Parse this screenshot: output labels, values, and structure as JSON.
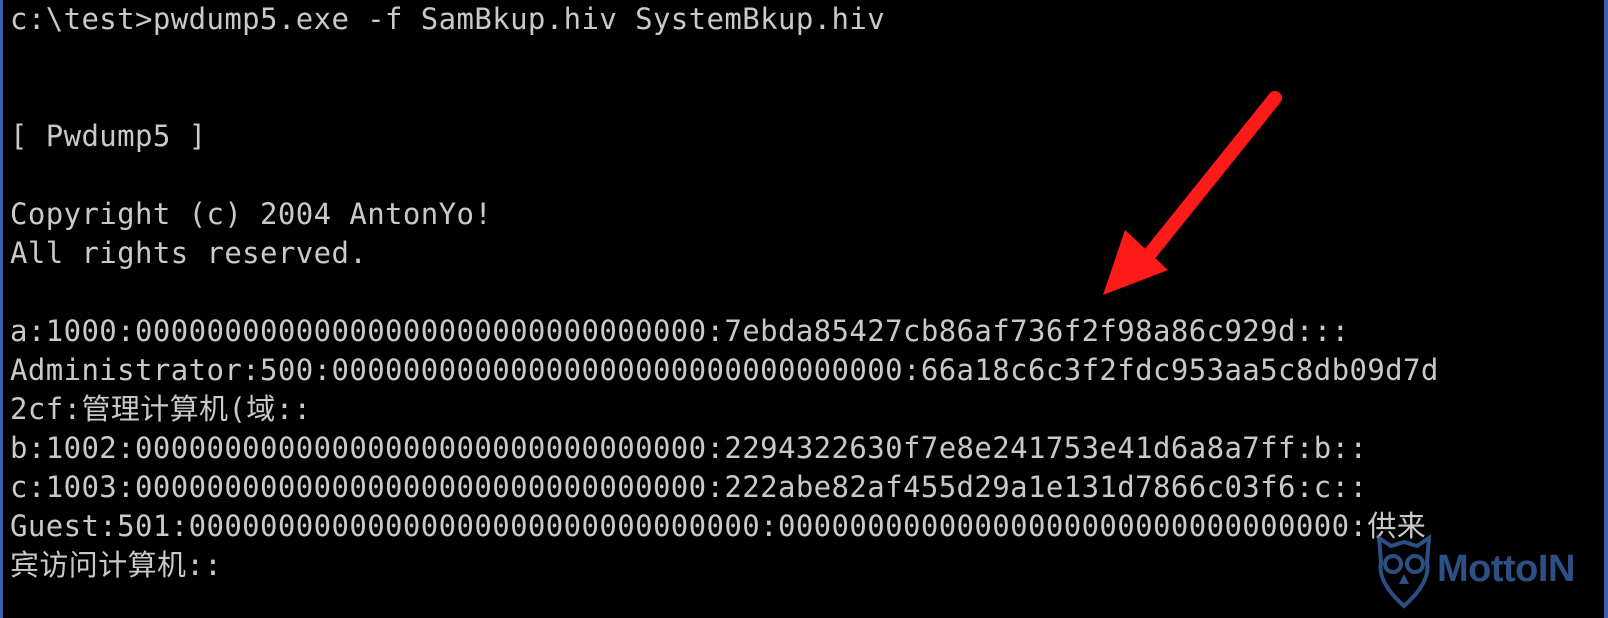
{
  "console": {
    "lines": [
      "c:\\test>pwdump5.exe -f SamBkup.hiv SystemBkup.hiv",
      "",
      "",
      "[ Pwdump5 ]",
      "",
      "Copyright (c) 2004 AntonYo!",
      "All rights reserved.",
      "",
      "a:1000:00000000000000000000000000000000:7ebda85427cb86af736f2f98a86c929d:::",
      "Administrator:500:00000000000000000000000000000000:66a18c6c3f2fdc953aa5c8db09d7d",
      "2cf:管理计算机(域::",
      "b:1002:00000000000000000000000000000000:2294322630f7e8e241753e41d6a8a7ff:b::",
      "c:1003:00000000000000000000000000000000:222abe82af455d29a1e131d7866c03f6:c::",
      "Guest:501:00000000000000000000000000000000:00000000000000000000000000000000:供来",
      "宾访问计算机::"
    ]
  },
  "annotation": {
    "arrow_color": "#ff1a1a"
  },
  "watermark": {
    "text": "MottoIN",
    "color": "#3e6fb7"
  },
  "colors": {
    "background": "#000000",
    "text": "#c9c9c9",
    "frame": "#3b5fa8"
  }
}
